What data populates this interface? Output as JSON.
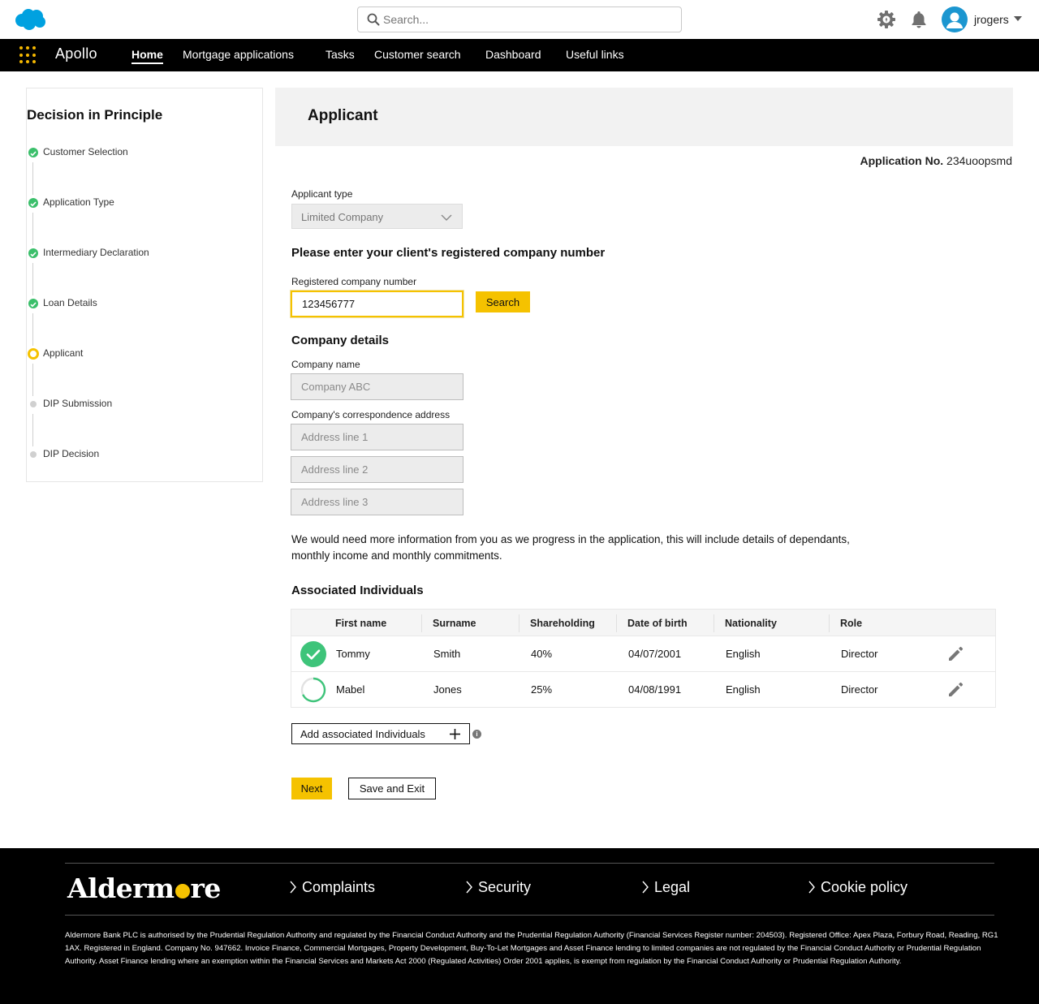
{
  "topbar": {
    "logo": "salesforce-cloud-logo",
    "search_placeholder": "Search...",
    "username": "jrogers",
    "icons": [
      "settings-gear-icon",
      "notification-bell-icon",
      "user-avatar-icon"
    ]
  },
  "nav": {
    "app_name": "Apollo",
    "items": [
      "Home",
      "Mortgage applications",
      "Tasks",
      "Customer search",
      "Dashboard",
      "Useful links"
    ],
    "active": "Home"
  },
  "sidebar": {
    "title": "Decision in Principle",
    "steps": [
      {
        "label": "Customer Selection",
        "status": "complete"
      },
      {
        "label": "Application Type",
        "status": "complete"
      },
      {
        "label": "Intermediary Declaration",
        "status": "complete"
      },
      {
        "label": "Loan Details",
        "status": "complete"
      },
      {
        "label": "Applicant",
        "status": "current"
      },
      {
        "label": "DIP Submission",
        "status": "todo"
      },
      {
        "label": "DIP Decision",
        "status": "todo"
      }
    ]
  },
  "main": {
    "title": "Applicant",
    "application_no_label": "Application No.",
    "application_no": "234uoopsmd",
    "applicant_type_label": "Applicant type",
    "applicant_type_value": "Limited Company",
    "company_number_heading": "Please enter your client's registered company number",
    "company_number_label": "Registered company number",
    "company_number_value": "123456777",
    "search_button": "Search",
    "company_details_heading": "Company details",
    "company_name_label": "Company name",
    "company_name_placeholder": "Company ABC",
    "address_label": "Company's correspondence address",
    "address_placeholders": [
      "Address line 1",
      "Address line 2",
      "Address line 3"
    ],
    "info_text": "We would need more information from you as we progress in the application, this will include details of dependants, monthly income and monthly commitments.",
    "associated_heading": "Associated Individuals",
    "table": {
      "columns": [
        "First name",
        "Surname",
        "Shareholding",
        "Date of birth",
        "Nationality",
        "Role"
      ],
      "rows": [
        {
          "status": "complete",
          "first_name": "Tommy",
          "surname": "Smith",
          "shareholding": "40%",
          "dob": "04/07/2001",
          "nationality": "English",
          "role": "Director"
        },
        {
          "status": "in-progress",
          "first_name": "Mabel",
          "surname": "Jones",
          "shareholding": "25%",
          "dob": "04/08/1991",
          "nationality": "English",
          "role": "Director"
        }
      ]
    },
    "add_button": "Add associated Individuals",
    "next_button": "Next",
    "save_exit_button": "Save and Exit"
  },
  "footer": {
    "brand_before": "Alderm",
    "brand_after": "re",
    "links": [
      "Complaints",
      "Security",
      "Legal",
      "Cookie policy"
    ],
    "legal_text": "Aldermore Bank PLC is authorised by the Prudential Regulation Authority and regulated by the Financial Conduct Authority and the Prudential Regulation Authority (Financial Services Register number: 204503). Registered Office: Apex Plaza, Forbury Road, Reading, RG1 1AX. Registered in England. Company No. 947662. Invoice Finance, Commercial Mortgages, Property Development, Buy-To-Let Mortgages and Asset Finance lending to limited companies are not regulated by the Financial Conduct Authority or Prudential Regulation Authority. Asset Finance lending where an exemption within the Financial Services and Markets Act 2000 (Regulated Activities) Order 2001 applies, is exempt from regulation by the Financial Conduct Authority or Prudential Regulation Authority."
  },
  "colors": {
    "accent_yellow": "#f5c200",
    "success_green": "#3ec47a",
    "nav_black": "#000000",
    "avatar_blue": "#1b96d0",
    "salesforce_blue": "#00a1e0"
  }
}
